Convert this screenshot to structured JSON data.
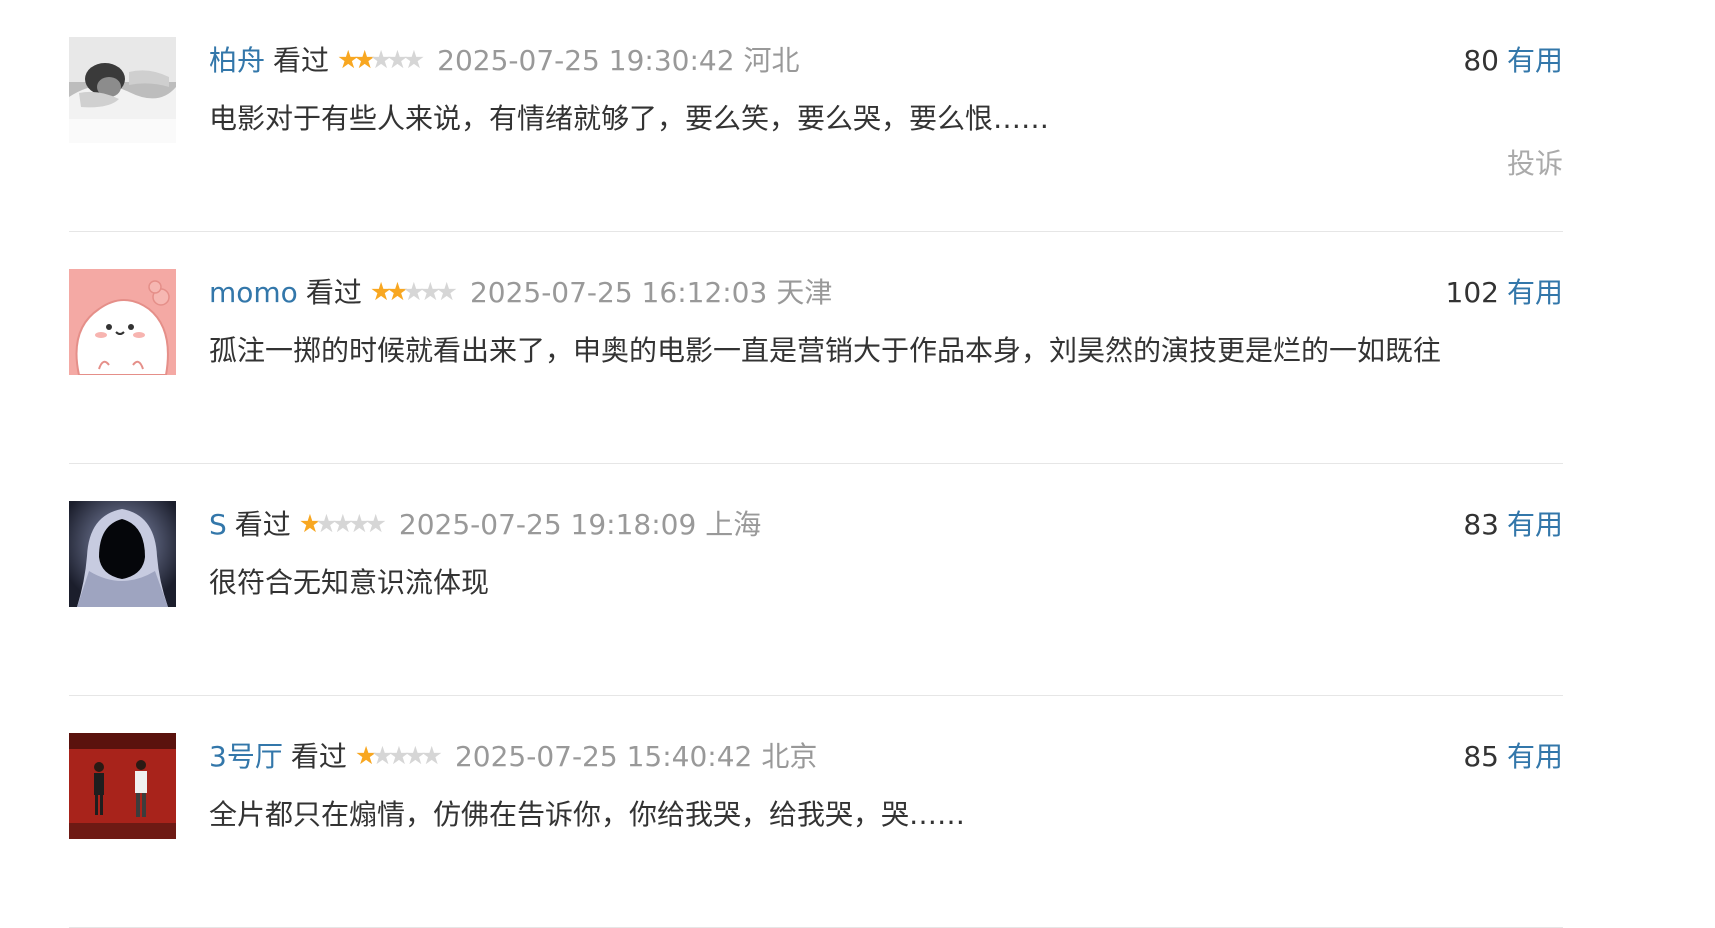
{
  "reviews": [
    {
      "user": "柏舟",
      "status": "看过",
      "rating": 2,
      "time": "2025-07-25 19:30:42",
      "location": "河北",
      "votes": "80",
      "useful_label": "有用",
      "content": "电影对于有些人来说，有情绪就够了，要么笑，要么哭，要么恨……",
      "report_label": "投诉",
      "avatar": "photo-woman-lying"
    },
    {
      "user": "momo",
      "status": "看过",
      "rating": 2,
      "time": "2025-07-25 16:12:03",
      "location": "天津",
      "votes": "102",
      "useful_label": "有用",
      "content": "孤注一掷的时候就看出来了，申奥的电影一直是营销大于作品本身，刘昊然的演技更是烂的一如既往",
      "avatar": "cartoon-pink-blob"
    },
    {
      "user": "S",
      "status": "看过",
      "rating": 1,
      "time": "2025-07-25 19:18:09",
      "location": "上海",
      "votes": "83",
      "useful_label": "有用",
      "content": "很符合无知意识流体现",
      "avatar": "hooded-figure"
    },
    {
      "user": "3号厅",
      "status": "看过",
      "rating": 1,
      "time": "2025-07-25 15:40:42",
      "location": "北京",
      "votes": "85",
      "useful_label": "有用",
      "content": "全片都只在煽情，仿佛在告诉你，你给我哭，给我哭，哭……",
      "avatar": "couple-red-wall"
    }
  ],
  "colors": {
    "link": "#3377aa",
    "star_on": "#f8a721",
    "star_off": "#d6d6d6",
    "muted": "#999999"
  }
}
